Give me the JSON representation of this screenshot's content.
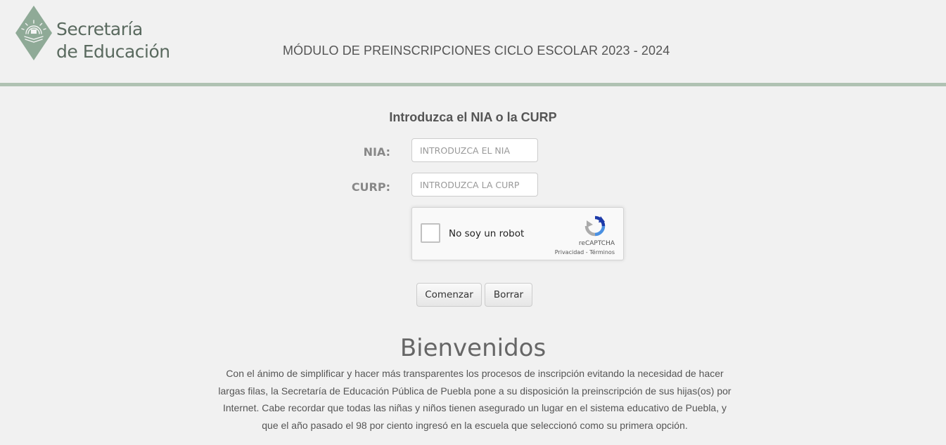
{
  "header": {
    "logo": {
      "line1": "Secretaría",
      "line2": "de Educación"
    },
    "module_title": "MÓDULO DE PREINSCRIPCIONES CICLO ESCOLAR 2023 - 2024"
  },
  "form": {
    "heading": "Introduzca el NIA o la CURP",
    "nia": {
      "label": "NIA:",
      "placeholder": "INTRODUZCA EL NIA",
      "value": ""
    },
    "curp": {
      "label": "CURP:",
      "placeholder": "INTRODUZCA LA CURP",
      "value": ""
    },
    "recaptcha": {
      "label": "No soy un robot",
      "brand": "reCAPTCHA",
      "privacy": "Privacidad",
      "separator": " - ",
      "terms": "Términos"
    },
    "buttons": {
      "start": "Comenzar",
      "clear": "Borrar"
    }
  },
  "welcome": {
    "title": "Bienvenidos",
    "text": "Con el ánimo de simplificar y hacer más transparentes los procesos de inscripción evitando la necesidad de hacer largas filas, la Secretaría de Educación Pública de Puebla pone a su disposición la preinscripción de sus hijas(os) por Internet. Cabe recordar que todas las niñas y niños tienen asegurado un lugar en el sistema educativo de Puebla, y que el año pasado el 98 por ciento ingresó en la escuela que seleccionó como su primera opción."
  },
  "colors": {
    "header_rule": "#b0c2b3",
    "logo_green": "#8faa97",
    "background": "#f1f1f1"
  }
}
